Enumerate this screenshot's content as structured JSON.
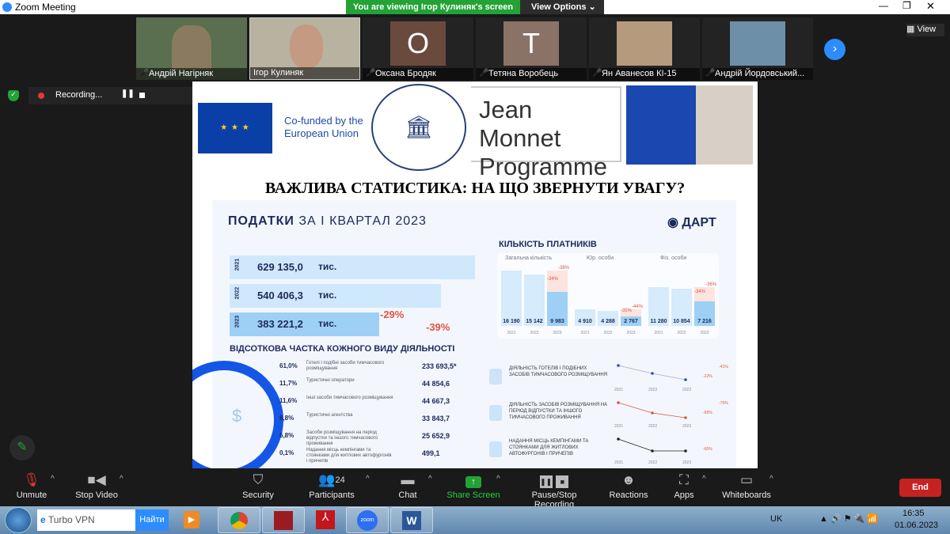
{
  "window": {
    "title": "Zoom Meeting",
    "banner": "You are viewing Ігор Кулиняк's screen",
    "view_options": "View Options",
    "view_label": "View",
    "recording": "Recording..."
  },
  "participants": [
    {
      "name": "Андрій Нагірняк",
      "initial": "",
      "video": true
    },
    {
      "name": "Ігор Кулиняк",
      "initial": "",
      "video": true
    },
    {
      "name": "Оксана Бродяк",
      "initial": "O",
      "video": false
    },
    {
      "name": "Тетяна Воробець",
      "initial": "T",
      "video": false
    },
    {
      "name": "Ян Аванесов КІ-15",
      "initial": "",
      "video": true
    },
    {
      "name": "Андрій Йордовський...",
      "initial": "",
      "video": true
    }
  ],
  "slide": {
    "cofunded": "Co-funded by the European Union",
    "programme_line1": "Jean Monnet",
    "programme_line2": "Programme",
    "heading": "ВАЖЛИВА СТАТИСТИКА: НА ЩО ЗВЕРНУТИ УВАГУ?",
    "info_title_bold": "ПОДАТКИ",
    "info_title_rest": "ЗА І КВАРТАЛ 2023",
    "brand": "ДАРТ",
    "revenue": [
      {
        "year": "2021",
        "value": "629 135,0",
        "unit": "тис.",
        "fraction": 1.0
      },
      {
        "year": "2022",
        "value": "540 406,3",
        "unit": "тис.",
        "fraction": 0.86
      },
      {
        "year": "2023",
        "value": "383 221,2",
        "unit": "тис.",
        "fraction": 0.61
      }
    ],
    "revenue_changes": [
      "-29%",
      "-39%"
    ],
    "payers_title": "КІЛЬКІСТЬ ПЛАТНИКІВ",
    "chart_data": {
      "type": "bar",
      "categories": [
        "2021",
        "2022",
        "2023"
      ],
      "series": [
        {
          "name": "Загальна кількість",
          "values": [
            16190,
            15142,
            9983
          ],
          "labels": [
            "16 190",
            "15 142",
            "9 983"
          ],
          "changes": [
            "-34%",
            "-38%"
          ]
        },
        {
          "name": "Юр. особи",
          "values": [
            4910,
            4288,
            2767
          ],
          "labels": [
            "4 910",
            "4 288",
            "2 767"
          ],
          "changes": [
            "-35%",
            "-44%"
          ]
        },
        {
          "name": "Фіз. особи",
          "values": [
            11280,
            10854,
            7216
          ],
          "labels": [
            "11 280",
            "10 854",
            "7 216"
          ],
          "changes": [
            "-34%",
            "-36%"
          ]
        }
      ]
    },
    "share_title": "ВІДСОТКОВА ЧАСТКА КОЖНОГО ВИДУ ДІЯЛЬНОСТІ",
    "shares": [
      {
        "pct": "61,0%",
        "label": "Готелі і подібні засоби тимчасового розміщування",
        "value": "233 693,5*",
        "color": "#1457e6"
      },
      {
        "pct": "11,7%",
        "label": "Туристичні оператори",
        "value": "44 854,6",
        "color": "#5bb6e8"
      },
      {
        "pct": "11,6%",
        "label": "Інші засоби тимчасового розміщування",
        "value": "44 667,3",
        "color": "#4cc0a6"
      },
      {
        "pct": "8,8%",
        "label": "Туристичні агентства",
        "value": "33 843,7",
        "color": "#a9d8f5"
      },
      {
        "pct": "6,8%",
        "label": "Засоби розміщування на період відпустки та іншого тимчасового проживання",
        "value": "25 652,9",
        "color": "#f3a23a"
      },
      {
        "pct": "0,1%",
        "label": "Надання місць кемпінгами та стоянками для житлових автофургонів і причепів",
        "value": "499,1",
        "color": "#e9542f"
      }
    ],
    "trends": [
      {
        "label": "ДІЯЛЬНІСТЬ ГОТЕЛІВ І ПОДІБНИХ ЗАСОБІВ ТИМЧАСОВОГО РОЗМІЩУВАННЯ",
        "color": "#2d4fb8",
        "changes": [
          "-22%",
          "-41%"
        ]
      },
      {
        "label": "ДІЯЛЬНІСТЬ ЗАСОБІВ РОЗМІЩУВАННЯ НА ПЕРІОД ВІДПУСТКИ ТА ІНШОГО ТИМЧАСОВОГО ПРОЖИВАННЯ",
        "color": "#e2553f",
        "changes": [
          "-65%",
          "-70%"
        ]
      },
      {
        "label": "НАДАННЯ МІСЦЬ КЕМПІНГАМИ ТА СТОЯНКАМИ ДЛЯ ЖИТЛОВИХ АВТОФУРГОНІВ І ПРИЧЕПІВ",
        "color": "#222",
        "changes": [
          "-60%",
          ""
        ]
      }
    ],
    "trend_years": [
      "2021",
      "2022",
      "2023"
    ]
  },
  "toolbar": {
    "unmute": "Unmute",
    "stop_video": "Stop Video",
    "security": "Security",
    "participants": "Participants",
    "participants_count": "24",
    "chat": "Chat",
    "share": "Share Screen",
    "recording": "Pause/Stop Recording",
    "reactions": "Reactions",
    "apps": "Apps",
    "whiteboards": "Whiteboards",
    "end": "End"
  },
  "taskbar": {
    "search_value": "Turbo VPN",
    "search_button": "Найти",
    "lang": "UK",
    "time": "16:35",
    "date": "01.06.2023"
  },
  "colors": {
    "zoom_green": "#23a236",
    "end_red": "#c72222",
    "slide_navy": "#1d2a5c"
  }
}
